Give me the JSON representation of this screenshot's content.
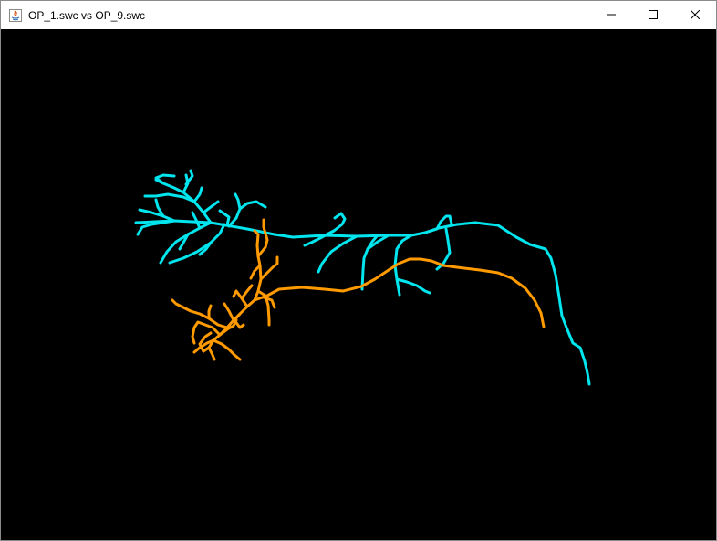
{
  "window": {
    "title": "OP_1.swc vs OP_9.swc",
    "background": "#000000",
    "controls": {
      "minimize_icon": "minimize-icon",
      "maximize_icon": "maximize-icon",
      "close_icon": "close-icon"
    }
  },
  "viewer": {
    "colors": {
      "neuron_a": "#00e5ee",
      "neuron_b": "#ff9a00"
    }
  }
}
